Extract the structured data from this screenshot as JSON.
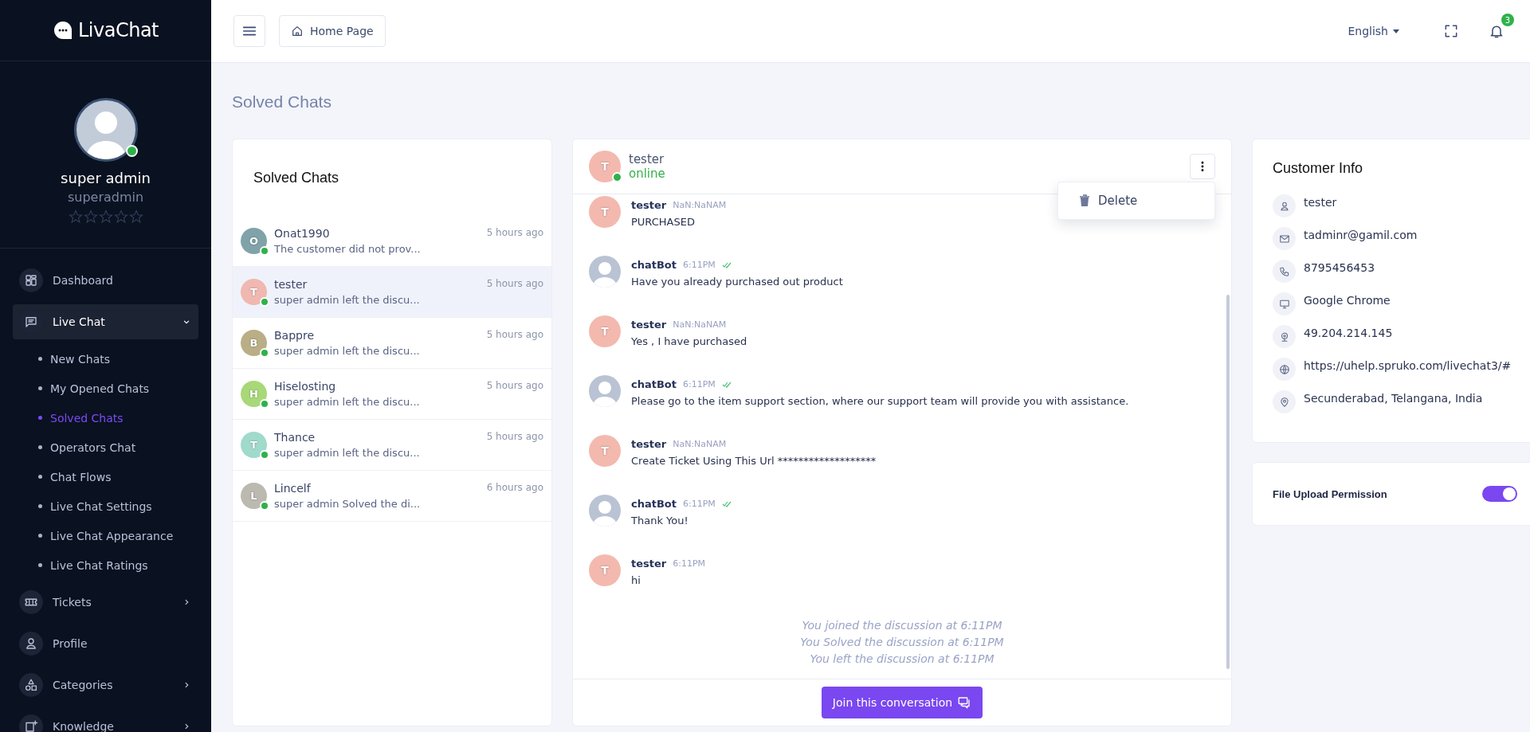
{
  "sidebar": {
    "logo": "LivaChat",
    "profile": {
      "name": "super admin",
      "username": "superadmin",
      "online": true,
      "stars": 0
    },
    "menu": [
      {
        "label": "Dashboard",
        "expandable": false,
        "selected": false
      },
      {
        "label": "Live Chat",
        "expandable": true,
        "expanded": true,
        "selected": true,
        "children": [
          {
            "label": "New Chats",
            "selected": false
          },
          {
            "label": "My Opened Chats",
            "selected": false
          },
          {
            "label": "Solved Chats",
            "selected": true
          },
          {
            "label": "Operators Chat",
            "selected": false
          },
          {
            "label": "Chat Flows",
            "selected": false
          },
          {
            "label": "Live Chat Settings",
            "selected": false
          },
          {
            "label": "Live Chat Appearance",
            "selected": false
          },
          {
            "label": "Live Chat Ratings",
            "selected": false
          }
        ]
      },
      {
        "label": "Tickets",
        "expandable": true,
        "expanded": false,
        "selected": false
      },
      {
        "label": "Profile",
        "expandable": false,
        "selected": false
      },
      {
        "label": "Categories",
        "expandable": true,
        "expanded": false,
        "selected": false
      },
      {
        "label": "Knowledge",
        "expandable": true,
        "expanded": false,
        "selected": false
      }
    ]
  },
  "header": {
    "home_button": "Home Page",
    "language": "English",
    "notification_count": "3"
  },
  "page_title": "Solved Chats",
  "chat_list": {
    "title": "Solved Chats",
    "items": [
      {
        "initial": "O",
        "color": "#7fa3a8",
        "name": "Onat1990",
        "time": "5 hours ago",
        "preview": "The customer did not prov...",
        "online": true,
        "selected": false
      },
      {
        "initial": "T",
        "color": "#efb8b0",
        "name": "tester",
        "time": "5 hours ago",
        "preview": "super admin left the discu...",
        "online": true,
        "selected": true
      },
      {
        "initial": "B",
        "color": "#b9ae86",
        "name": "Bappre",
        "time": "5 hours ago",
        "preview": "super admin left the discu...",
        "online": true,
        "selected": false
      },
      {
        "initial": "H",
        "color": "#a8d878",
        "name": "Hiselosting",
        "time": "5 hours ago",
        "preview": "super admin left the discu...",
        "online": true,
        "selected": false
      },
      {
        "initial": "T",
        "color": "#9fdacb",
        "name": "Thance",
        "time": "5 hours ago",
        "preview": "super admin left the discu...",
        "online": true,
        "selected": false
      },
      {
        "initial": "L",
        "color": "#bcb9b1",
        "name": "Lincelf",
        "time": "6 hours ago",
        "preview": "super admin Solved the di...",
        "online": true,
        "selected": false
      }
    ]
  },
  "conversation": {
    "contact": {
      "initial": "T",
      "name": "tester",
      "status": "online",
      "online": true
    },
    "menu": {
      "open": true,
      "items": [
        "Delete"
      ]
    },
    "messages": [
      {
        "kind": "user",
        "initial": "T",
        "sender": "tester",
        "time": "NaN:NaNAM",
        "read": false,
        "text": "PURCHASED"
      },
      {
        "kind": "bot",
        "sender": "chatBot",
        "time": "6:11PM",
        "read": true,
        "text": "Have you already purchased out product"
      },
      {
        "kind": "user",
        "initial": "T",
        "sender": "tester",
        "time": "NaN:NaNAM",
        "read": false,
        "text": "Yes , I have purchased"
      },
      {
        "kind": "bot",
        "sender": "chatBot",
        "time": "6:11PM",
        "read": true,
        "text": "Please go to the item support section, where our support team will provide you with assistance."
      },
      {
        "kind": "user",
        "initial": "T",
        "sender": "tester",
        "time": "NaN:NaNAM",
        "read": false,
        "text": "Create Ticket Using This Url *******************"
      },
      {
        "kind": "bot",
        "sender": "chatBot",
        "time": "6:11PM",
        "read": true,
        "text": "Thank You!"
      },
      {
        "kind": "user",
        "initial": "T",
        "sender": "tester",
        "time": "6:11PM",
        "read": false,
        "text": "hi"
      }
    ],
    "events": [
      "You joined the discussion at 6:11PM",
      "You Solved the discussion at 6:11PM",
      "You left the discussion at 6:11PM"
    ],
    "join_button": "Join this conversation"
  },
  "customer_info": {
    "title": "Customer Info",
    "fields": [
      "tester",
      "tadminr@gamil.com",
      "8795456453",
      "Google Chrome",
      "49.204.214.145",
      "https://uhelp.spruko.com/livechat3/#",
      "Secunderabad, Telangana, India"
    ]
  },
  "file_upload": {
    "label": "File Upload Permission",
    "on": true
  }
}
